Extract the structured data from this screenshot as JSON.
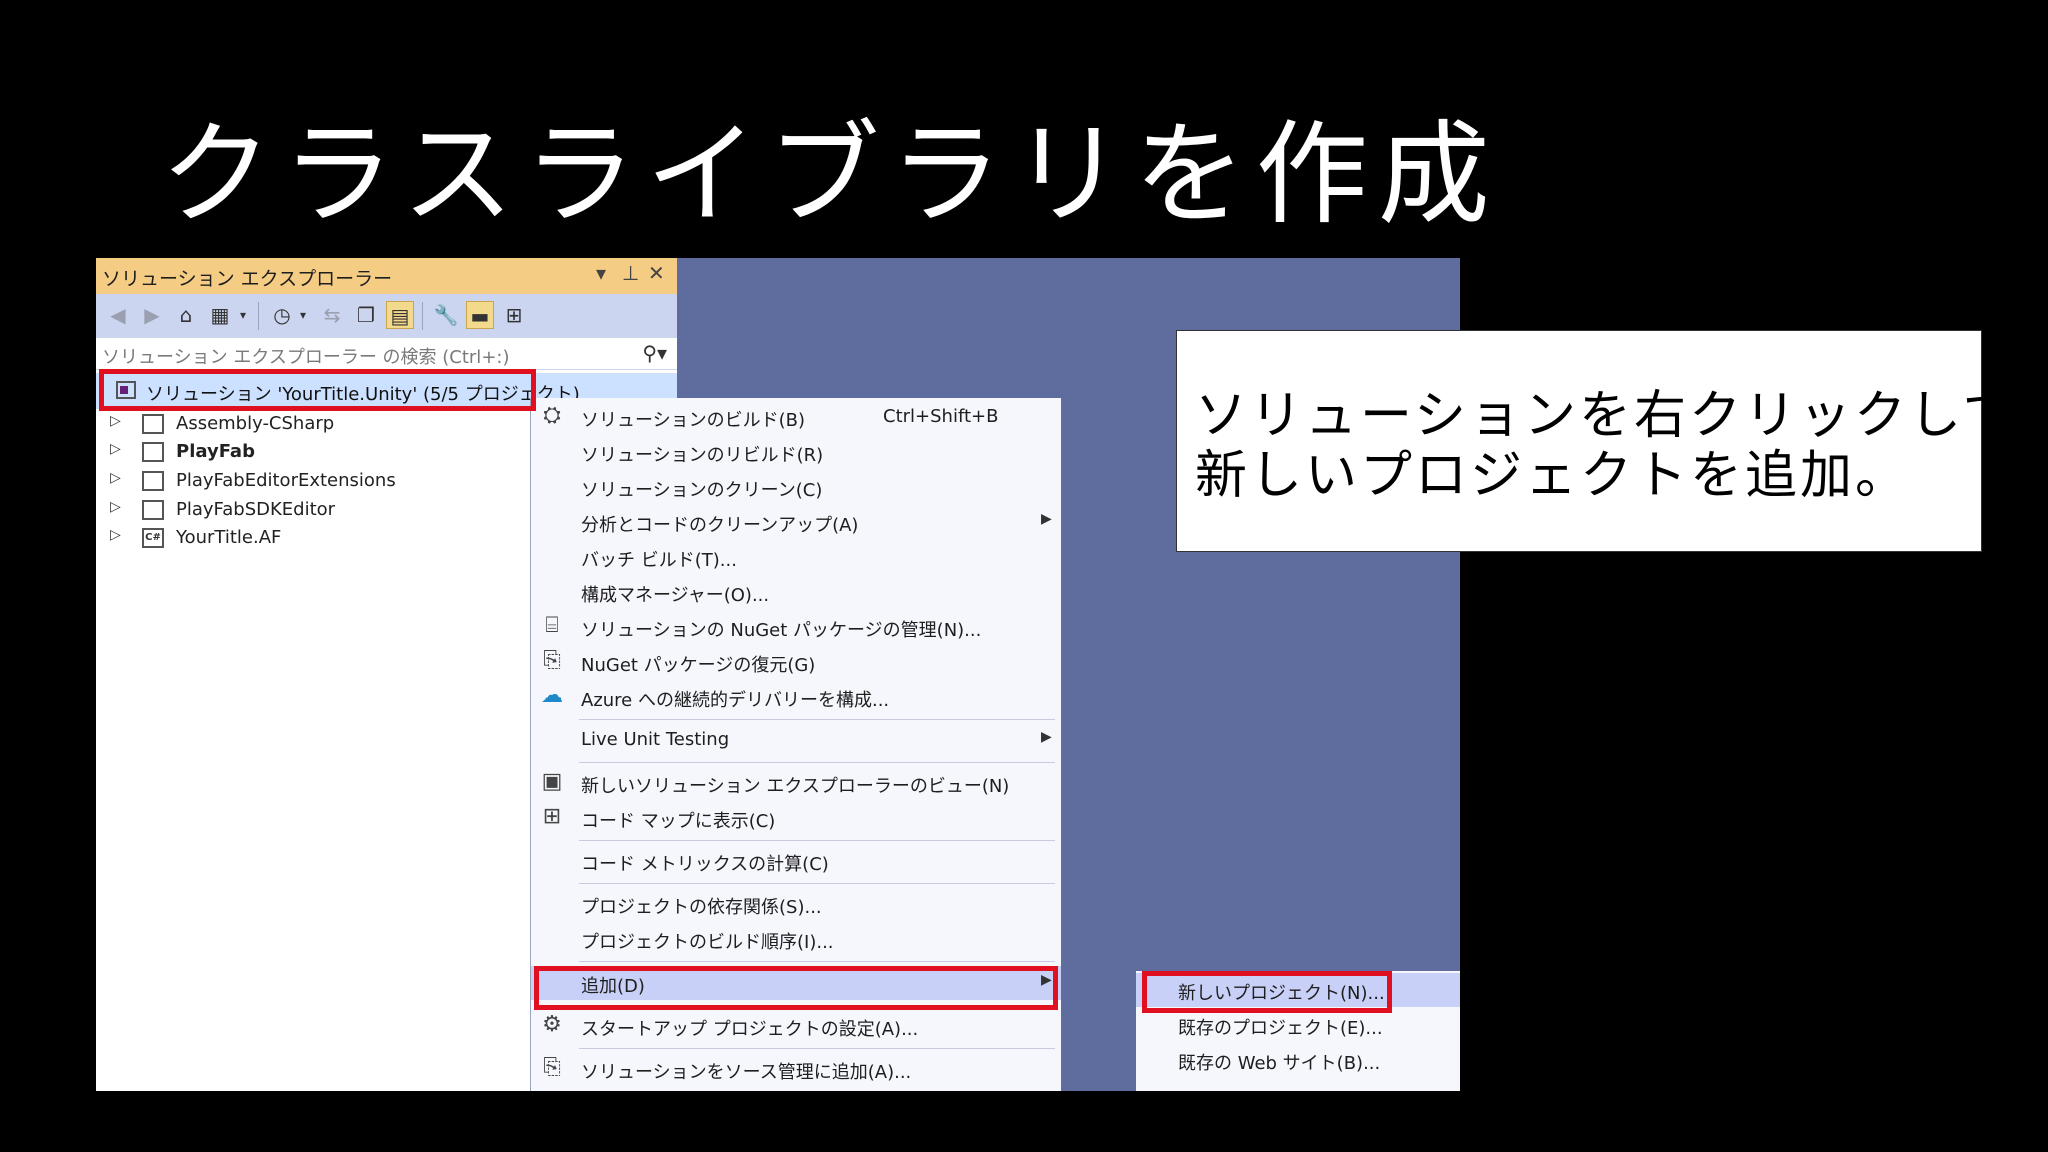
{
  "slide": {
    "title": "クラスライブラリを作成",
    "callout": {
      "line1": "ソリューションを右クリックして",
      "line2": "新しいプロジェクトを追加。"
    }
  },
  "solution_explorer": {
    "title": "ソリューション エクスプローラー",
    "title_controls": [
      "▾",
      "⊥",
      "✕"
    ],
    "search_placeholder": "ソリューション エクスプローラー の検索 (Ctrl+:)",
    "root_label": "ソリューション 'YourTitle.Unity' (5/5 プロジェクト)",
    "projects": [
      {
        "label": "Assembly-CSharp",
        "bold": false,
        "icon": "unity-project-icon"
      },
      {
        "label": "PlayFab",
        "bold": true,
        "icon": "unity-project-icon"
      },
      {
        "label": "PlayFabEditorExtensions",
        "bold": false,
        "icon": "unity-project-icon"
      },
      {
        "label": "PlayFabSDKEditor",
        "bold": false,
        "icon": "unity-project-icon"
      },
      {
        "label": "YourTitle.AF",
        "bold": false,
        "icon": "csharp-project-icon",
        "icon_text": "C#"
      }
    ]
  },
  "context_menu": {
    "items": [
      {
        "label": "ソリューションのビルド(B)",
        "shortcut": "Ctrl+Shift+B",
        "icon": "build-icon"
      },
      {
        "label": "ソリューションのリビルド(R)"
      },
      {
        "label": "ソリューションのクリーン(C)"
      },
      {
        "label": "分析とコードのクリーンアップ(A)",
        "submenu": true
      },
      {
        "label": "バッチ ビルド(T)..."
      },
      {
        "label": "構成マネージャー(O)..."
      },
      {
        "label": "ソリューションの NuGet パッケージの管理(N)...",
        "icon": "nuget-icon"
      },
      {
        "label": "NuGet パッケージの復元(G)",
        "icon": "restore-package-icon"
      },
      {
        "label": "Azure への継続的デリバリーを構成...",
        "icon": "azure-cloud-icon"
      },
      {
        "label": "Live Unit Testing",
        "submenu": true
      },
      {
        "label": "新しいソリューション エクスプローラーのビュー(N)",
        "icon": "new-view-icon"
      },
      {
        "label": "コード マップに表示(C)",
        "icon": "code-map-icon"
      },
      {
        "label": "コード メトリックスの計算(C)"
      },
      {
        "label": "プロジェクトの依存関係(S)..."
      },
      {
        "label": "プロジェクトのビルド順序(I)..."
      },
      {
        "label": "追加(D)",
        "submenu": true,
        "highlighted": true
      },
      {
        "label": "スタートアップ プロジェクトの設定(A)...",
        "icon": "gear-icon"
      },
      {
        "label": "ソリューションをソース管理に追加(A)...",
        "icon": "source-control-add-icon"
      }
    ]
  },
  "add_submenu": {
    "items": [
      {
        "label": "新しいプロジェクト(N)...",
        "highlighted": true
      },
      {
        "label": "既存のプロジェクト(E)..."
      },
      {
        "label": "既存の Web サイト(B)..."
      }
    ]
  },
  "colors": {
    "background": "#000000",
    "titlebar": "#f5cc84",
    "toolbar": "#ccd5f0",
    "ide_backdrop": "#5e6c9e",
    "menu_bg": "#f5f7fd",
    "menu_highlight": "#c8d0f7",
    "annotation_red": "#e01020"
  }
}
